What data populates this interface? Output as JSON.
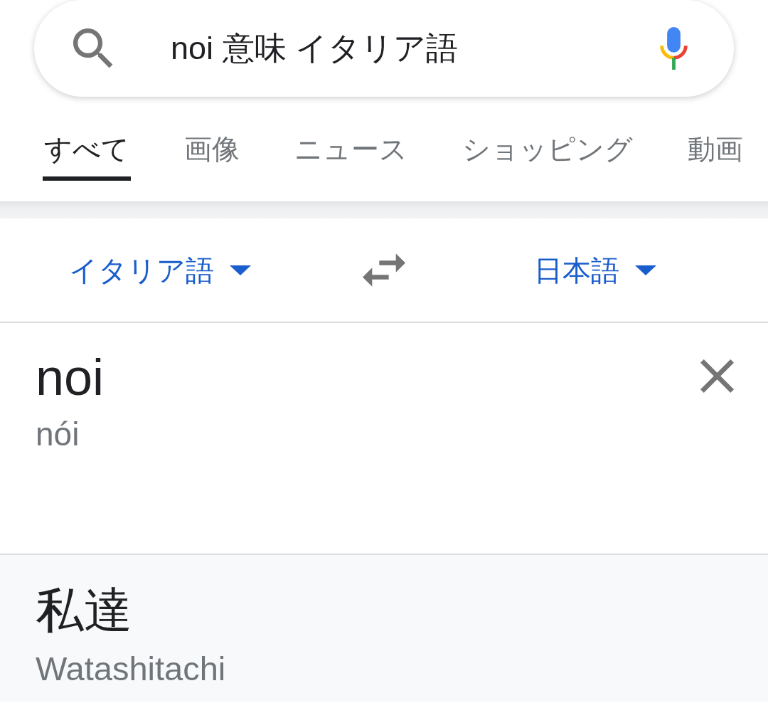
{
  "search": {
    "query": "noi 意味 イタリア語"
  },
  "tabs": [
    {
      "label": "すべて",
      "selected": true
    },
    {
      "label": "画像",
      "selected": false
    },
    {
      "label": "ニュース",
      "selected": false
    },
    {
      "label": "ショッピング",
      "selected": false
    },
    {
      "label": "動画",
      "selected": false
    }
  ],
  "translator": {
    "source_language": "イタリア語",
    "target_language": "日本語",
    "source": {
      "text": "noi",
      "pronunciation": "nói"
    },
    "result": {
      "text": "私達",
      "romanization": "Watashitachi"
    }
  }
}
